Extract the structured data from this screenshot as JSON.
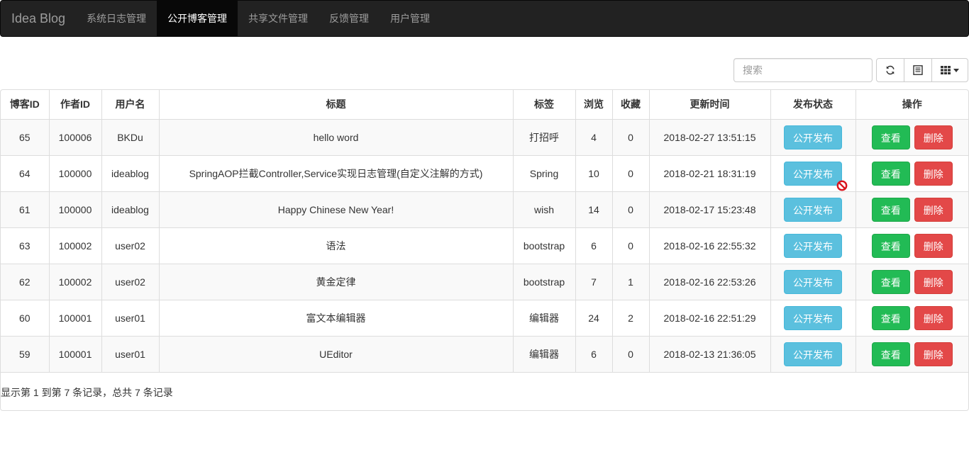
{
  "navbar": {
    "brand": "Idea Blog",
    "items": [
      {
        "label": "系统日志管理",
        "active": false
      },
      {
        "label": "公开博客管理",
        "active": true
      },
      {
        "label": "共享文件管理",
        "active": false
      },
      {
        "label": "反馈管理",
        "active": false
      },
      {
        "label": "用户管理",
        "active": false
      }
    ]
  },
  "toolbar": {
    "search_placeholder": "搜索",
    "refresh_icon": "refresh-icon",
    "toggle_icon": "list-view-icon",
    "columns_icon": "columns-grid-icon"
  },
  "table": {
    "headers": [
      "博客ID",
      "作者ID",
      "用户名",
      "标题",
      "标签",
      "浏览",
      "收藏",
      "更新时间",
      "发布状态",
      "操作"
    ],
    "rows": [
      {
        "blog_id": "65",
        "author_id": "100006",
        "username": "BKDu",
        "title": "hello word",
        "tag": "打招呼",
        "views": "4",
        "favorites": "0",
        "updated": "2018-02-27 13:51:15"
      },
      {
        "blog_id": "64",
        "author_id": "100000",
        "username": "ideablog",
        "title": "SpringAOP拦截Controller,Service实现日志管理(自定义注解的方式)",
        "tag": "Spring",
        "views": "10",
        "favorites": "0",
        "updated": "2018-02-21 18:31:19"
      },
      {
        "blog_id": "61",
        "author_id": "100000",
        "username": "ideablog",
        "title": "Happy Chinese New Year!",
        "tag": "wish",
        "views": "14",
        "favorites": "0",
        "updated": "2018-02-17 15:23:48"
      },
      {
        "blog_id": "63",
        "author_id": "100002",
        "username": "user02",
        "title": "语法",
        "tag": "bootstrap",
        "views": "6",
        "favorites": "0",
        "updated": "2018-02-16 22:55:32"
      },
      {
        "blog_id": "62",
        "author_id": "100002",
        "username": "user02",
        "title": "黄金定律",
        "tag": "bootstrap",
        "views": "7",
        "favorites": "1",
        "updated": "2018-02-16 22:53:26"
      },
      {
        "blog_id": "60",
        "author_id": "100001",
        "username": "user01",
        "title": "富文本编辑器",
        "tag": "编辑器",
        "views": "24",
        "favorites": "2",
        "updated": "2018-02-16 22:51:29"
      },
      {
        "blog_id": "59",
        "author_id": "100001",
        "username": "user01",
        "title": "UEditor",
        "tag": "编辑器",
        "views": "6",
        "favorites": "0",
        "updated": "2018-02-13 21:36:05"
      }
    ],
    "publish_label": "公开发布",
    "view_label": "查看",
    "delete_label": "删除",
    "hover_cursor_row": 1
  },
  "footer": {
    "info": "显示第 1 到第 7 条记录，总共 7 条记录"
  },
  "colors": {
    "navbar_bg": "#222222",
    "info": "#5bc0de",
    "success": "#22bb55",
    "danger": "#e34848"
  }
}
